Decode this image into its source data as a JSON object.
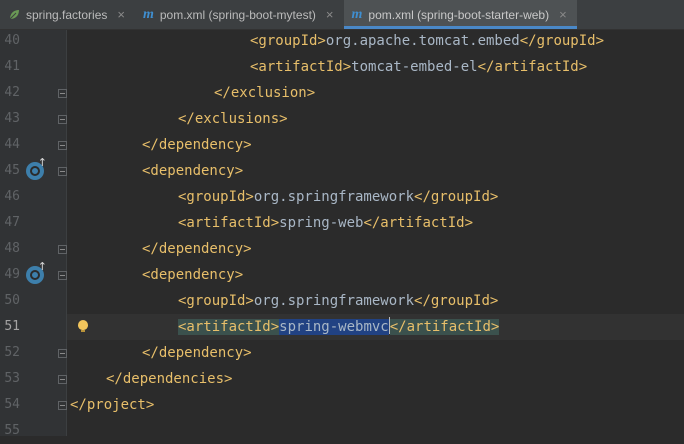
{
  "tabs": [
    {
      "label": "spring.factories",
      "icon": "leaf-icon",
      "active": false
    },
    {
      "label": "pom.xml (spring-boot-mytest)",
      "icon": "maven-m-icon",
      "active": false
    },
    {
      "label": "pom.xml (spring-boot-starter-web)",
      "icon": "maven-m-icon",
      "active": true
    }
  ],
  "lines": [
    {
      "n": "40",
      "p": [
        [
          "tag",
          "<groupId>"
        ],
        [
          "txt",
          "org.apache.tomcat.embed"
        ],
        [
          "tag",
          "</groupId>"
        ]
      ]
    },
    {
      "n": "41",
      "p": [
        [
          "tag",
          "<artifactId>"
        ],
        [
          "txt",
          "tomcat-embed-el"
        ],
        [
          "tag",
          "</artifactId>"
        ]
      ]
    },
    {
      "n": "42",
      "p": [
        [
          "tag",
          "</exclusion>"
        ]
      ]
    },
    {
      "n": "43",
      "p": [
        [
          "tag",
          "</exclusions>"
        ]
      ]
    },
    {
      "n": "44",
      "p": [
        [
          "tag",
          "</dependency>"
        ]
      ]
    },
    {
      "n": "45",
      "p": [
        [
          "tag",
          "<dependency>"
        ]
      ]
    },
    {
      "n": "46",
      "p": [
        [
          "tag",
          "<groupId>"
        ],
        [
          "txt",
          "org.springframework"
        ],
        [
          "tag",
          "</groupId>"
        ]
      ]
    },
    {
      "n": "47",
      "p": [
        [
          "tag",
          "<artifactId>"
        ],
        [
          "txt",
          "spring-web"
        ],
        [
          "tag",
          "</artifactId>"
        ]
      ]
    },
    {
      "n": "48",
      "p": [
        [
          "tag",
          "</dependency>"
        ]
      ]
    },
    {
      "n": "49",
      "p": [
        [
          "tag",
          "<dependency>"
        ]
      ]
    },
    {
      "n": "50",
      "p": [
        [
          "tag",
          "<groupId>"
        ],
        [
          "txt",
          "org.springframework"
        ],
        [
          "tag",
          "</groupId>"
        ]
      ]
    },
    {
      "n": "51",
      "p": [
        [
          "tag",
          "<artifactId>"
        ],
        [
          "sel",
          "spring-webmvc"
        ],
        [
          "tag",
          "</artifactId>"
        ]
      ]
    },
    {
      "n": "52",
      "p": [
        [
          "tag",
          "</dependency>"
        ]
      ]
    },
    {
      "n": "53",
      "p": [
        [
          "tag",
          "</dependencies>"
        ]
      ]
    },
    {
      "n": "54",
      "p": [
        [
          "tag",
          "</project>"
        ]
      ]
    },
    {
      "n": "55",
      "p": []
    }
  ],
  "current_line": "51",
  "colors": {
    "tag": "#e8bf6a",
    "text": "#a9b7c6",
    "selection": "#214283",
    "line_number": "#606366"
  }
}
